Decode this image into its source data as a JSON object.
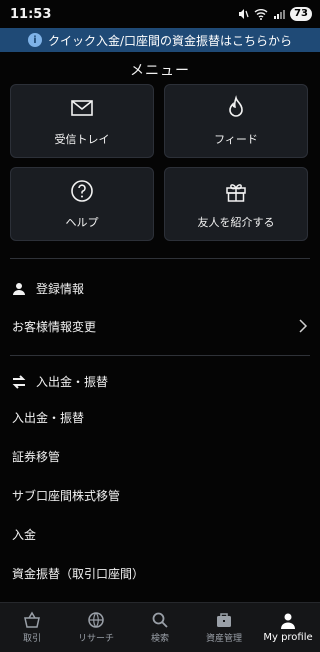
{
  "status": {
    "time": "11:53",
    "battery": "73"
  },
  "banner": {
    "text": "クイック入金/口座間の資金振替はこちらから"
  },
  "menu": {
    "title": "メニュー",
    "tiles": [
      {
        "label": "受信トレイ",
        "icon": "mail-icon"
      },
      {
        "label": "フィード",
        "icon": "flame-icon"
      },
      {
        "label": "ヘルプ",
        "icon": "help-icon"
      },
      {
        "label": "友人を紹介する",
        "icon": "gift-icon"
      }
    ]
  },
  "sections": {
    "registration": {
      "title": "登録情報",
      "items": [
        "お客様情報変更"
      ]
    },
    "transfer": {
      "title": "入出金・振替",
      "items": [
        "入出金・振替",
        "証券移管",
        "サブ口座間株式移管",
        "入金",
        "資金振替（取引口座間）"
      ]
    }
  },
  "tabs": [
    {
      "label": "取引",
      "icon": "basket-icon"
    },
    {
      "label": "リサーチ",
      "icon": "globe-icon"
    },
    {
      "label": "検索",
      "icon": "search-icon"
    },
    {
      "label": "資産管理",
      "icon": "briefcase-icon"
    },
    {
      "label": "My profile",
      "icon": "person-icon",
      "active": true
    }
  ]
}
